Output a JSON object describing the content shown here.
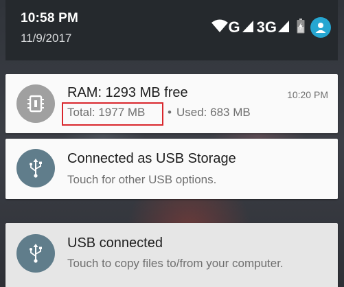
{
  "status_bar": {
    "time": "10:58 PM",
    "date": "11/9/2017",
    "network_label_1": "G",
    "network_label_2": "3G",
    "icons": [
      "wifi-icon",
      "signal-icon",
      "signal-icon",
      "battery-icon",
      "account-icon"
    ]
  },
  "notifications": [
    {
      "icon": "memory-chip-icon",
      "title": "RAM: 1293 MB free",
      "time": "10:20 PM",
      "total": "Total: 1977 MB",
      "separator": "•",
      "used": "Used: 683 MB"
    },
    {
      "icon": "usb-icon",
      "title": "Connected as USB Storage",
      "text": "Touch for other USB options."
    },
    {
      "icon": "usb-icon",
      "title": "USB connected",
      "text": "Touch to copy files to/from your computer."
    }
  ],
  "colors": {
    "panel_bg": "#25292d",
    "icon_grey": "#a0a0a0",
    "icon_slate": "#607d8b",
    "avatar_blue": "#26a6d1",
    "highlight_red": "#d9262c"
  }
}
